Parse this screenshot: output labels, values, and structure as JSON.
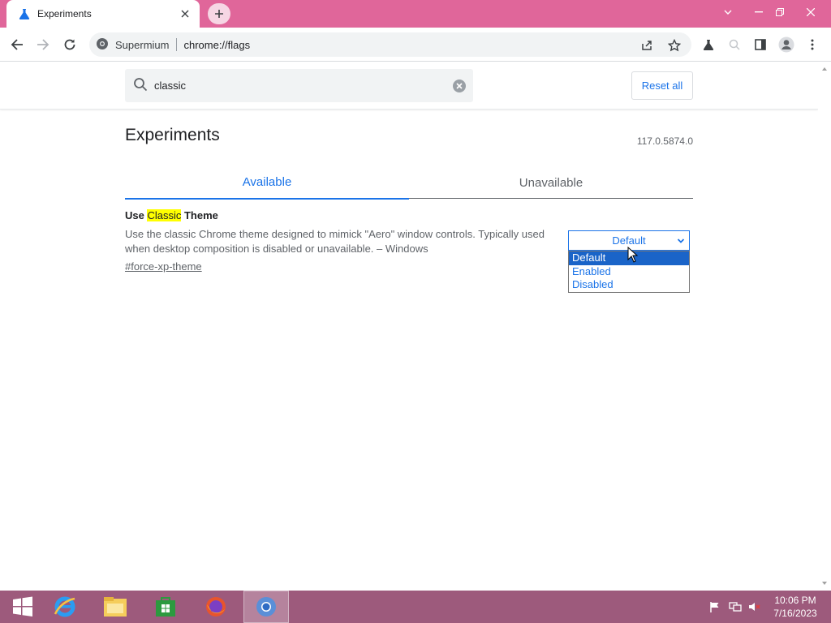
{
  "browser": {
    "tab_title": "Experiments",
    "site_name": "Supermium",
    "url": "chrome://flags"
  },
  "page": {
    "search_value": "classic",
    "reset_label": "Reset all",
    "heading": "Experiments",
    "version": "117.0.5874.0",
    "tabs": [
      {
        "label": "Available"
      },
      {
        "label": "Unavailable"
      }
    ],
    "experiment": {
      "title_prefix": "Use ",
      "title_highlight": "Classic",
      "title_suffix": " Theme",
      "description": "Use the classic Chrome theme designed to mimick \"Aero\" window controls. Typically used when desktop composition is disabled or unavailable. – Windows",
      "link": "#force-xp-theme",
      "selected_value": "Default",
      "options": [
        "Default",
        "Enabled",
        "Disabled"
      ]
    }
  },
  "taskbar": {
    "time": "10:06 PM",
    "date": "7/16/2023"
  },
  "colors": {
    "accent": "#1a73e8",
    "tabstrip": "#e0669a",
    "taskbar": "#9d5a7c",
    "highlight": "#ffff00"
  }
}
